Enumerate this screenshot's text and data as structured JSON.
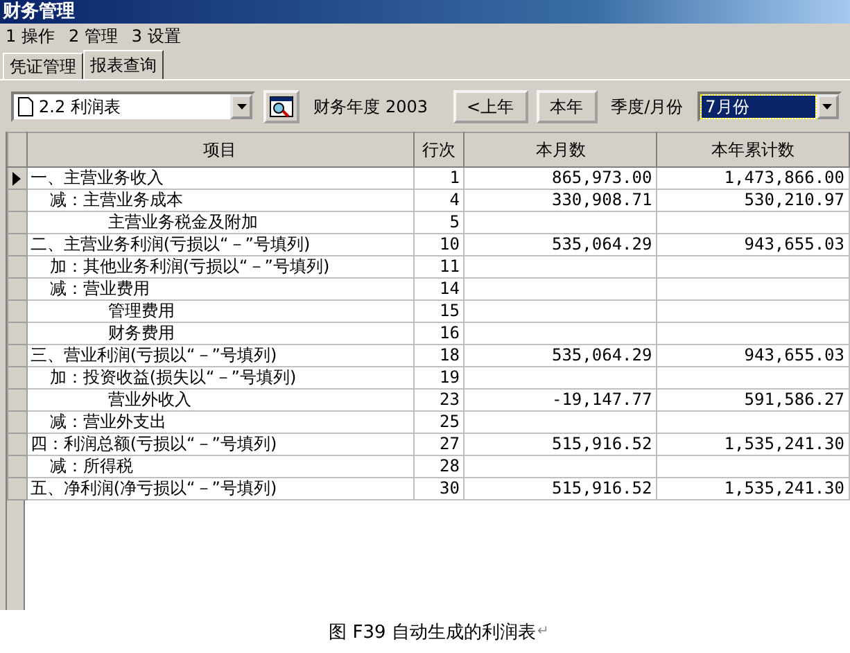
{
  "window": {
    "title": "财务管理"
  },
  "menu": [
    "1 操作",
    "2 管理",
    "3 设置"
  ],
  "tabs": [
    {
      "label": "凭证管理",
      "selected": false
    },
    {
      "label": "报表查询",
      "selected": true
    }
  ],
  "toolbar": {
    "report": "2.2 利润表",
    "year_label": "财务年度",
    "year": "2003",
    "prev_button": "<上年",
    "current_button": "本年",
    "period_label": "季度/月份",
    "period": "7月份"
  },
  "table": {
    "columns": [
      "项目",
      "行次",
      "本月数",
      "本年累计数"
    ],
    "rows": [
      {
        "kind": "main",
        "item": "一、主营业务收入",
        "line": "1",
        "month": "865,973.00",
        "year": "1,473,866.00",
        "selected": true
      },
      {
        "kind": "adjust",
        "item": "减：主营业务成本",
        "line": "4",
        "month": "330,908.71",
        "year": "530,210.97",
        "selected": false
      },
      {
        "kind": "detail",
        "item": "主营业务税金及附加",
        "line": "5",
        "selected": false
      },
      {
        "kind": "main",
        "item": "二、主营业务利润(亏损以“－”号填列)",
        "line": "10",
        "month": "535,064.29",
        "year": "943,655.03",
        "selected": false
      },
      {
        "kind": "adjust",
        "item": "加：其他业务利润(亏损以“－”号填列)",
        "line": "11",
        "selected": false
      },
      {
        "kind": "adjust",
        "item": "减：营业费用",
        "line": "14",
        "selected": false
      },
      {
        "kind": "detail",
        "item": "管理费用",
        "line": "15",
        "selected": false
      },
      {
        "kind": "detail",
        "item": "财务费用",
        "line": "16",
        "selected": false
      },
      {
        "kind": "main",
        "item": "三、营业利润(亏损以“－”号填列)",
        "line": "18",
        "month": "535,064.29",
        "year": "943,655.03",
        "selected": false
      },
      {
        "kind": "adjust",
        "item": "加：投资收益(损失以“－”号填列)",
        "line": "19",
        "selected": false
      },
      {
        "kind": "detail",
        "item": "营业外收入",
        "line": "23",
        "month": "-19,147.77",
        "year": "591,586.27",
        "selected": false
      },
      {
        "kind": "adjust",
        "item": "减：营业外支出",
        "line": "25",
        "selected": false
      },
      {
        "kind": "main",
        "item": "四：利润总额(亏损以“－”号填列)",
        "line": "27",
        "month": "515,916.52",
        "year": "1,535,241.30",
        "selected": false
      },
      {
        "kind": "adjust",
        "item": "减：所得税",
        "line": "28",
        "selected": false
      },
      {
        "kind": "main",
        "item": "五、净利润(净亏损以“－”号填列)",
        "line": "30",
        "month": "515,916.52",
        "year": "1,535,241.30",
        "selected": false
      }
    ]
  },
  "caption": {
    "text": "图 F39 自动生成的利润表",
    "mark": "↵"
  }
}
